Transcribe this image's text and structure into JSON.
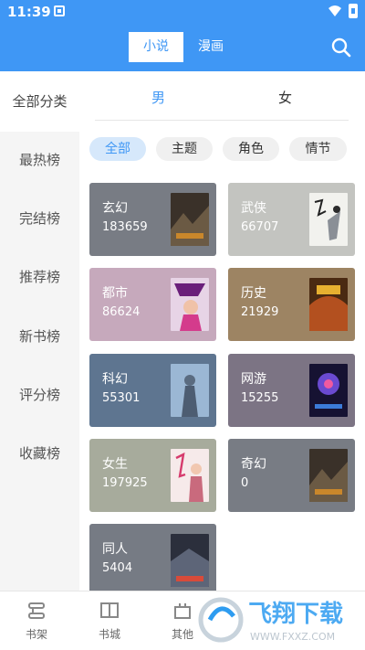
{
  "status": {
    "time": "11:39"
  },
  "header": {
    "tabs": [
      {
        "label": "小说",
        "active": true
      },
      {
        "label": "漫画",
        "active": false
      }
    ],
    "accent": "#3f97f5"
  },
  "sidebar": {
    "all_label": "全部分类",
    "items": [
      {
        "label": "最热榜"
      },
      {
        "label": "完结榜"
      },
      {
        "label": "推荐榜"
      },
      {
        "label": "新书榜"
      },
      {
        "label": "评分榜"
      },
      {
        "label": "收藏榜"
      }
    ]
  },
  "gender": {
    "male": "男",
    "female": "女",
    "active": "男"
  },
  "chips": [
    {
      "label": "全部",
      "active": true
    },
    {
      "label": "主题",
      "active": false
    },
    {
      "label": "角色",
      "active": false
    },
    {
      "label": "情节",
      "active": false
    }
  ],
  "categories": [
    {
      "name": "玄幻",
      "count": "183659",
      "color": "#787c84"
    },
    {
      "name": "武侠",
      "count": "66707",
      "color": "#c3c4c0"
    },
    {
      "name": "都市",
      "count": "86624",
      "color": "#c6a9bc"
    },
    {
      "name": "历史",
      "count": "21929",
      "color": "#9d8463"
    },
    {
      "name": "科幻",
      "count": "55301",
      "color": "#5e7590"
    },
    {
      "name": "网游",
      "count": "15255",
      "color": "#7c7484"
    },
    {
      "name": "女生",
      "count": "197925",
      "color": "#a7ab9c"
    },
    {
      "name": "奇幻",
      "count": "0",
      "color": "#787c84"
    },
    {
      "name": "同人",
      "count": "5404",
      "color": "#767b84"
    }
  ],
  "bottom_nav": [
    {
      "label": "书架",
      "icon": "bookshelf-icon"
    },
    {
      "label": "书城",
      "icon": "book-icon"
    },
    {
      "label": "其他",
      "icon": "other-icon"
    }
  ],
  "watermark": {
    "text": "飞翔下载",
    "url": "WWW.FXXZ.COM"
  }
}
